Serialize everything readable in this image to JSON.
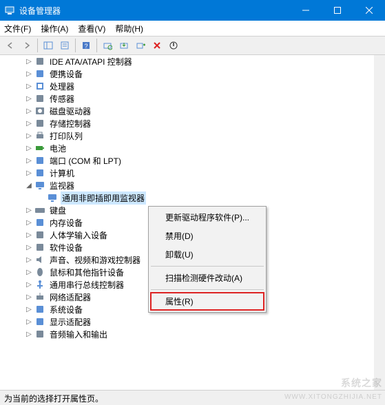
{
  "window": {
    "title": "设备管理器"
  },
  "menu": {
    "file": "文件(F)",
    "action": "操作(A)",
    "view": "查看(V)",
    "help": "帮助(H)"
  },
  "tree": [
    {
      "indent": 1,
      "expander": "▷",
      "icon": "ide",
      "label": "IDE ATA/ATAPI 控制器"
    },
    {
      "indent": 1,
      "expander": "▷",
      "icon": "portable",
      "label": "便携设备"
    },
    {
      "indent": 1,
      "expander": "▷",
      "icon": "cpu",
      "label": "处理器"
    },
    {
      "indent": 1,
      "expander": "▷",
      "icon": "sensor",
      "label": "传感器"
    },
    {
      "indent": 1,
      "expander": "▷",
      "icon": "disk",
      "label": "磁盘驱动器"
    },
    {
      "indent": 1,
      "expander": "▷",
      "icon": "storage",
      "label": "存储控制器"
    },
    {
      "indent": 1,
      "expander": "▷",
      "icon": "printer",
      "label": "打印队列"
    },
    {
      "indent": 1,
      "expander": "▷",
      "icon": "battery",
      "label": "电池"
    },
    {
      "indent": 1,
      "expander": "▷",
      "icon": "port",
      "label": "端口 (COM 和 LPT)"
    },
    {
      "indent": 1,
      "expander": "▷",
      "icon": "computer",
      "label": "计算机"
    },
    {
      "indent": 1,
      "expander": "◢",
      "icon": "monitor",
      "label": "监视器"
    },
    {
      "indent": 2,
      "expander": "",
      "icon": "monitor",
      "label": "通用非即插即用监视器",
      "selected": true
    },
    {
      "indent": 1,
      "expander": "▷",
      "icon": "keyboard",
      "label": "键盘"
    },
    {
      "indent": 1,
      "expander": "▷",
      "icon": "memory",
      "label": "内存设备"
    },
    {
      "indent": 1,
      "expander": "▷",
      "icon": "hid",
      "label": "人体学输入设备"
    },
    {
      "indent": 1,
      "expander": "▷",
      "icon": "software",
      "label": "软件设备"
    },
    {
      "indent": 1,
      "expander": "▷",
      "icon": "audio",
      "label": "声音、视频和游戏控制器"
    },
    {
      "indent": 1,
      "expander": "▷",
      "icon": "mouse",
      "label": "鼠标和其他指针设备"
    },
    {
      "indent": 1,
      "expander": "▷",
      "icon": "usb",
      "label": "通用串行总线控制器"
    },
    {
      "indent": 1,
      "expander": "▷",
      "icon": "network",
      "label": "网络适配器"
    },
    {
      "indent": 1,
      "expander": "▷",
      "icon": "system",
      "label": "系统设备"
    },
    {
      "indent": 1,
      "expander": "▷",
      "icon": "display",
      "label": "显示适配器"
    },
    {
      "indent": 1,
      "expander": "▷",
      "icon": "audioio",
      "label": "音频输入和输出"
    }
  ],
  "context_menu": {
    "update_driver": "更新驱动程序软件(P)...",
    "disable": "禁用(D)",
    "uninstall": "卸载(U)",
    "scan": "扫描检测硬件改动(A)",
    "properties": "属性(R)"
  },
  "status": "为当前的选择打开属性页。",
  "watermark": {
    "zh": "系统之家",
    "en": "WWW.XITONGZHIJIA.NET"
  },
  "icon_colors": {
    "ide": "#7a8a9a",
    "portable": "#5a8fd6",
    "cpu": "#5a8fd6",
    "sensor": "#7a8a9a",
    "disk": "#7a8a9a",
    "storage": "#7a8a9a",
    "printer": "#7a8a9a",
    "battery": "#3a9a3a",
    "port": "#5a8fd6",
    "computer": "#5a8fd6",
    "monitor": "#5a8fd6",
    "keyboard": "#7a8a9a",
    "memory": "#5a8fd6",
    "hid": "#7a8a9a",
    "software": "#7a8a9a",
    "audio": "#7a8a9a",
    "mouse": "#7a8a9a",
    "usb": "#5a8fd6",
    "network": "#7a8a9a",
    "system": "#5a8fd6",
    "display": "#5a8fd6",
    "audioio": "#7a8a9a"
  }
}
